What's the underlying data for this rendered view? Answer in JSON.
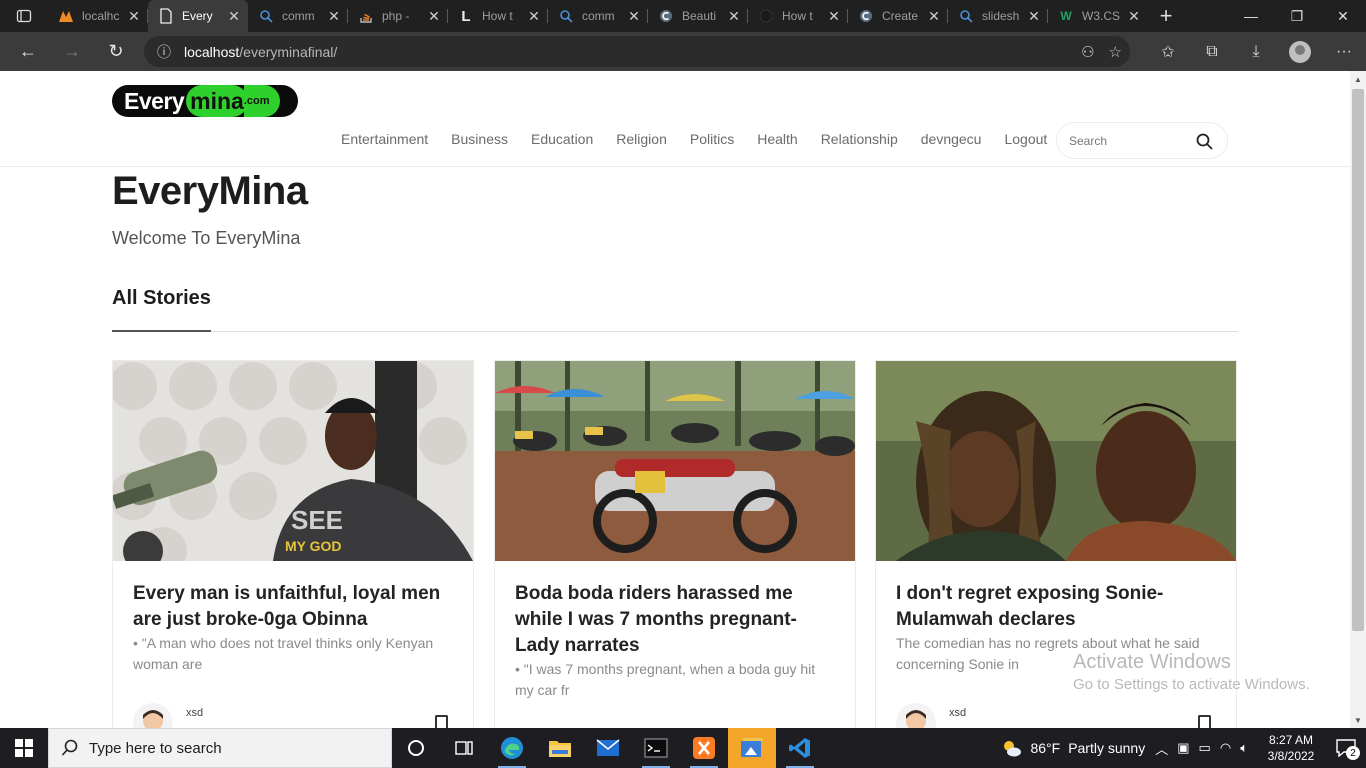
{
  "browser": {
    "tabs": [
      {
        "title": "localhc",
        "favicon": "xampp-icon",
        "active": false
      },
      {
        "title": "Every",
        "favicon": "page-icon",
        "active": true
      },
      {
        "title": "comm",
        "favicon": "search-icon",
        "active": false
      },
      {
        "title": "php - ",
        "favicon": "stackoverflow-icon",
        "active": false
      },
      {
        "title": "How t",
        "favicon": "letter-l-icon",
        "active": false
      },
      {
        "title": "comm",
        "favicon": "search-icon",
        "active": false
      },
      {
        "title": "Beauti",
        "favicon": "codepen-icon",
        "active": false
      },
      {
        "title": "How t",
        "favicon": "github-icon",
        "active": false
      },
      {
        "title": "Create",
        "favicon": "codepen-icon",
        "active": false
      },
      {
        "title": "slidesh",
        "favicon": "search-icon",
        "active": false
      },
      {
        "title": "W3.CS",
        "favicon": "w3schools-icon",
        "active": false
      }
    ],
    "url_host": "localhost",
    "url_path": "/everyminafinal/"
  },
  "site": {
    "logo_every": "Every",
    "logo_mina": "mina",
    "logo_com": ".com",
    "nav": [
      "Entertainment",
      "Business",
      "Education",
      "Religion",
      "Politics",
      "Health",
      "Relationship",
      "devngecu",
      "Logout"
    ],
    "search_placeholder": "Search",
    "title": "EveryMina",
    "tagline": "Welcome To EveryMina",
    "section_title": "All Stories"
  },
  "stories": [
    {
      "title": "Every man is unfaithful, loyal men are just broke-0ga Obinna",
      "excerpt": "• \"A man who does not travel thinks only Kenyan woman are",
      "author": "xsd"
    },
    {
      "title": "Boda boda riders harassed me while I was 7 months pregnant- Lady narrates",
      "excerpt": "• \"I was 7 months pregnant, when a boda guy hit my car fr",
      "author": ""
    },
    {
      "title": "I don't regret exposing Sonie-Mulamwah declares",
      "excerpt": "The comedian has no regrets about what he said concerning Sonie in",
      "author": "xsd"
    }
  ],
  "watermark": {
    "line1": "Activate Windows",
    "line2": "Go to Settings to activate Windows."
  },
  "taskbar": {
    "search_placeholder": "Type here to search",
    "weather_temp": "86°F",
    "weather_desc": "Partly sunny",
    "time": "8:27 AM",
    "date": "3/8/2022",
    "notification_count": "2"
  }
}
